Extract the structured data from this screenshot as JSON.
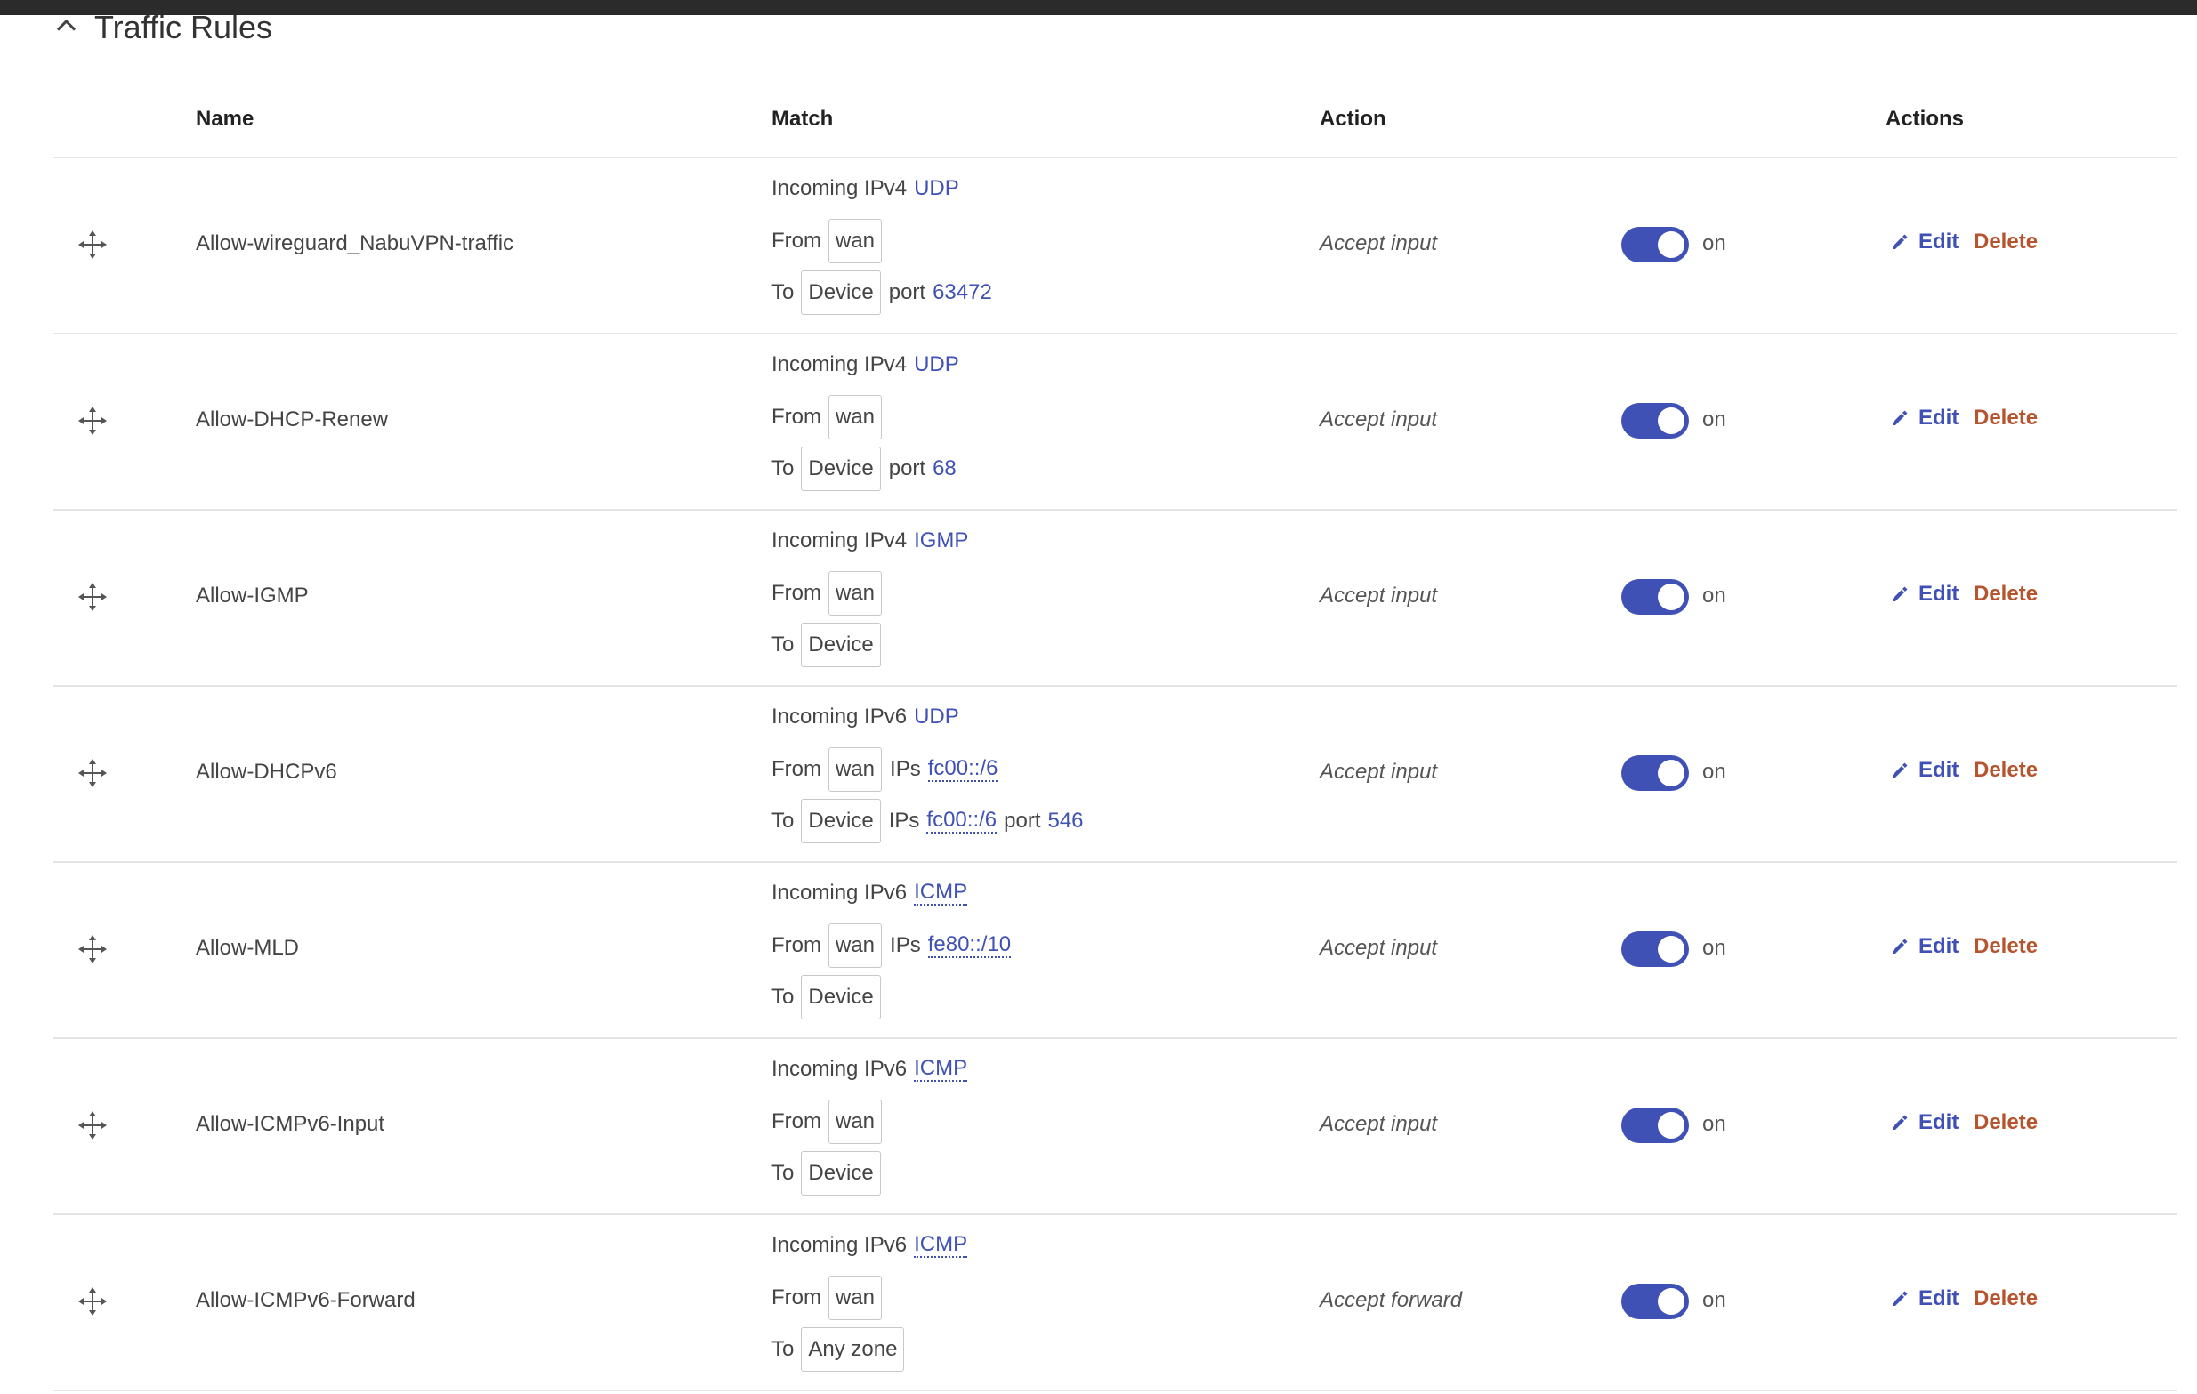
{
  "section": {
    "title": "Traffic Rules"
  },
  "columns": {
    "name": "Name",
    "match": "Match",
    "action": "Action",
    "actions": "Actions"
  },
  "labels": {
    "from": "From",
    "to": "To",
    "ips": "IPs",
    "port": "port",
    "edit": "Edit",
    "delete": "Delete",
    "state_on": "on"
  },
  "rules": [
    {
      "name": "Allow-wireguard_NabuVPN-traffic",
      "direction": "Incoming IPv4",
      "protocol": "UDP",
      "protocol_dotted": false,
      "from_zone": "wan",
      "from_ips": "",
      "to_zone": "Device",
      "to_ips": "",
      "to_port": "63472",
      "action": "Accept input",
      "enabled": true
    },
    {
      "name": "Allow-DHCP-Renew",
      "direction": "Incoming IPv4",
      "protocol": "UDP",
      "protocol_dotted": false,
      "from_zone": "wan",
      "from_ips": "",
      "to_zone": "Device",
      "to_ips": "",
      "to_port": "68",
      "action": "Accept input",
      "enabled": true
    },
    {
      "name": "Allow-IGMP",
      "direction": "Incoming IPv4",
      "protocol": "IGMP",
      "protocol_dotted": false,
      "from_zone": "wan",
      "from_ips": "",
      "to_zone": "Device",
      "to_ips": "",
      "to_port": "",
      "action": "Accept input",
      "enabled": true
    },
    {
      "name": "Allow-DHCPv6",
      "direction": "Incoming IPv6",
      "protocol": "UDP",
      "protocol_dotted": false,
      "from_zone": "wan",
      "from_ips": "fc00::/6",
      "to_zone": "Device",
      "to_ips": "fc00::/6",
      "to_port": "546",
      "action": "Accept input",
      "enabled": true
    },
    {
      "name": "Allow-MLD",
      "direction": "Incoming IPv6",
      "protocol": "ICMP",
      "protocol_dotted": true,
      "from_zone": "wan",
      "from_ips": "fe80::/10",
      "to_zone": "Device",
      "to_ips": "",
      "to_port": "",
      "action": "Accept input",
      "enabled": true
    },
    {
      "name": "Allow-ICMPv6-Input",
      "direction": "Incoming IPv6",
      "protocol": "ICMP",
      "protocol_dotted": true,
      "from_zone": "wan",
      "from_ips": "",
      "to_zone": "Device",
      "to_ips": "",
      "to_port": "",
      "action": "Accept input",
      "enabled": true
    },
    {
      "name": "Allow-ICMPv6-Forward",
      "direction": "Incoming IPv6",
      "protocol": "ICMP",
      "protocol_dotted": true,
      "from_zone": "wan",
      "from_ips": "",
      "to_zone": "Any zone",
      "to_ips": "",
      "to_port": "",
      "action": "Accept forward",
      "enabled": true
    }
  ],
  "colors": {
    "accent": "#3f51b5",
    "delete": "#b5542d",
    "topbar": "#2b2b2b"
  }
}
